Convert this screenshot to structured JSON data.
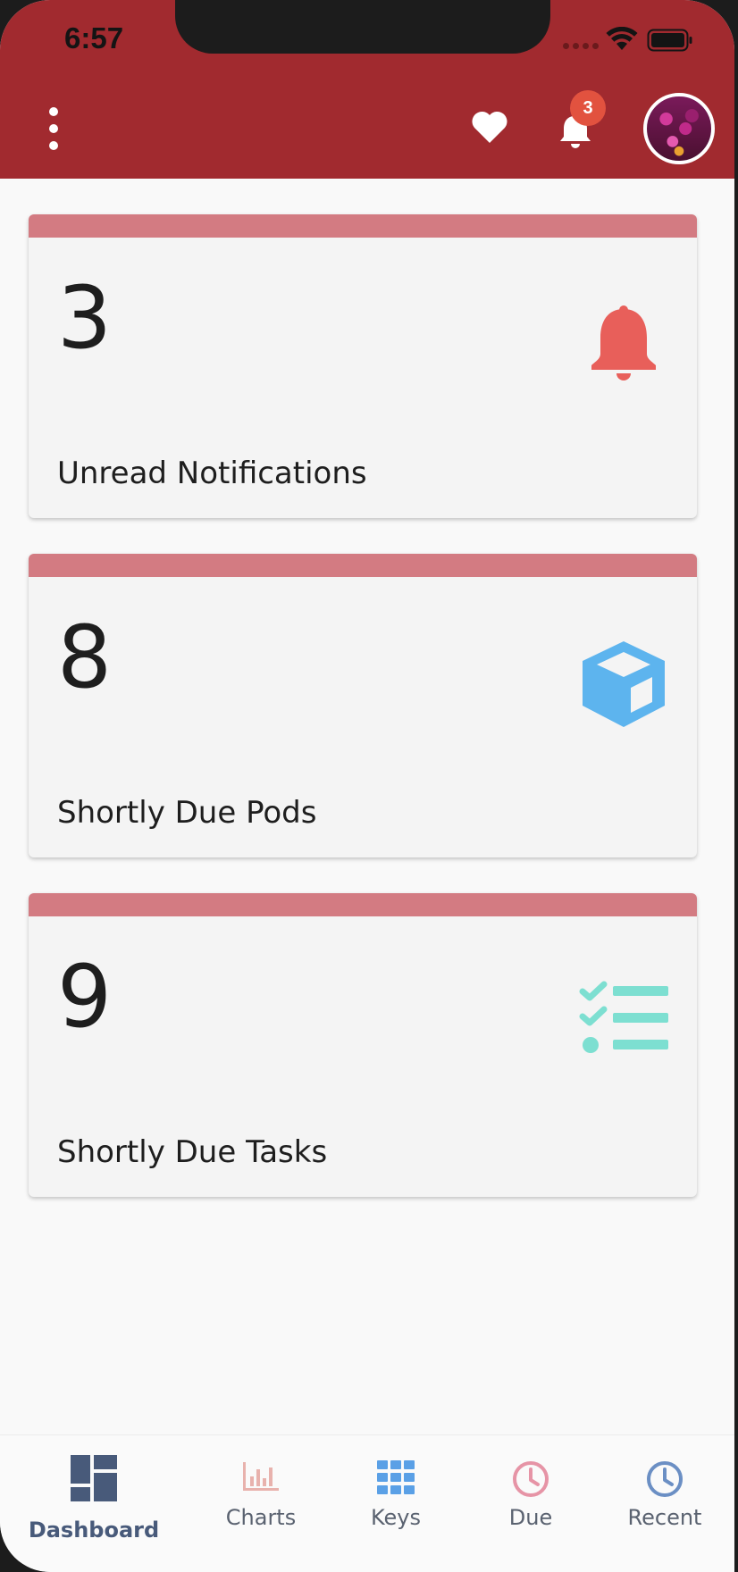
{
  "status_bar": {
    "time": "6:57"
  },
  "header": {
    "notification_count": "3",
    "icons": [
      "more-vertical-icon",
      "heart-icon",
      "bell-icon",
      "avatar"
    ]
  },
  "cards": [
    {
      "count": "3",
      "label": "Unread Notifications",
      "icon": "bell-icon",
      "icon_color": "#e85f5a"
    },
    {
      "count": "8",
      "label": "Shortly Due Pods",
      "icon": "cube-icon",
      "icon_color": "#5db4ee"
    },
    {
      "count": "9",
      "label": "Shortly Due Tasks",
      "icon": "task-list-icon",
      "icon_color": "#7ddfd1"
    }
  ],
  "bottom_nav": {
    "items": [
      {
        "label": "Dashboard",
        "icon": "dashboard-icon",
        "color": "#485a7a",
        "active": true
      },
      {
        "label": "Charts",
        "icon": "bar-chart-icon",
        "color": "#e8b2ad"
      },
      {
        "label": "Keys",
        "icon": "grid-icon",
        "color": "#5aa0e6"
      },
      {
        "label": "Due",
        "icon": "clock-icon",
        "color": "#e694a6"
      },
      {
        "label": "Recent",
        "icon": "clock-icon",
        "color": "#6b8fc4"
      }
    ]
  },
  "colors": {
    "header_bg": "#a12a2f",
    "card_accent": "#d37b82",
    "badge": "#e2523f"
  }
}
